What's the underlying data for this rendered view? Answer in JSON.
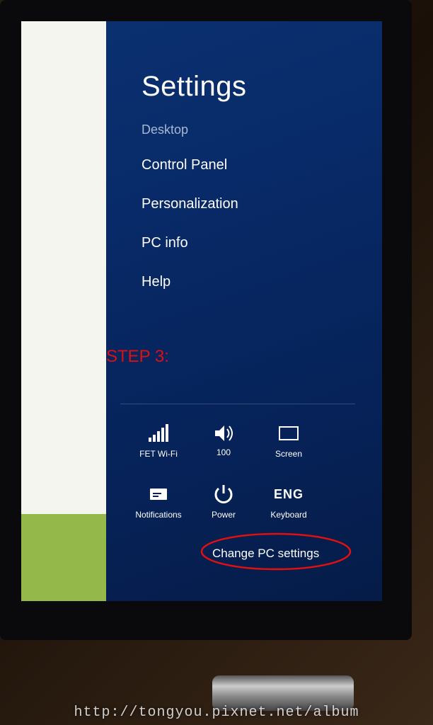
{
  "charm": {
    "title": "Settings",
    "subtitle": "Desktop",
    "items": [
      "Control Panel",
      "Personalization",
      "PC info",
      "Help"
    ],
    "change_pc": "Change PC settings"
  },
  "tiles": {
    "network": {
      "label": "FET Wi-Fi"
    },
    "volume": {
      "value": "100"
    },
    "screen": {
      "label": "Screen"
    },
    "notifications": {
      "label": "Notifications"
    },
    "power": {
      "label": "Power"
    },
    "keyboard": {
      "lang": "ENG",
      "label": "Keyboard"
    }
  },
  "annotation": {
    "step": "STEP 3:"
  },
  "watermark": "http://tongyou.pixnet.net/album"
}
